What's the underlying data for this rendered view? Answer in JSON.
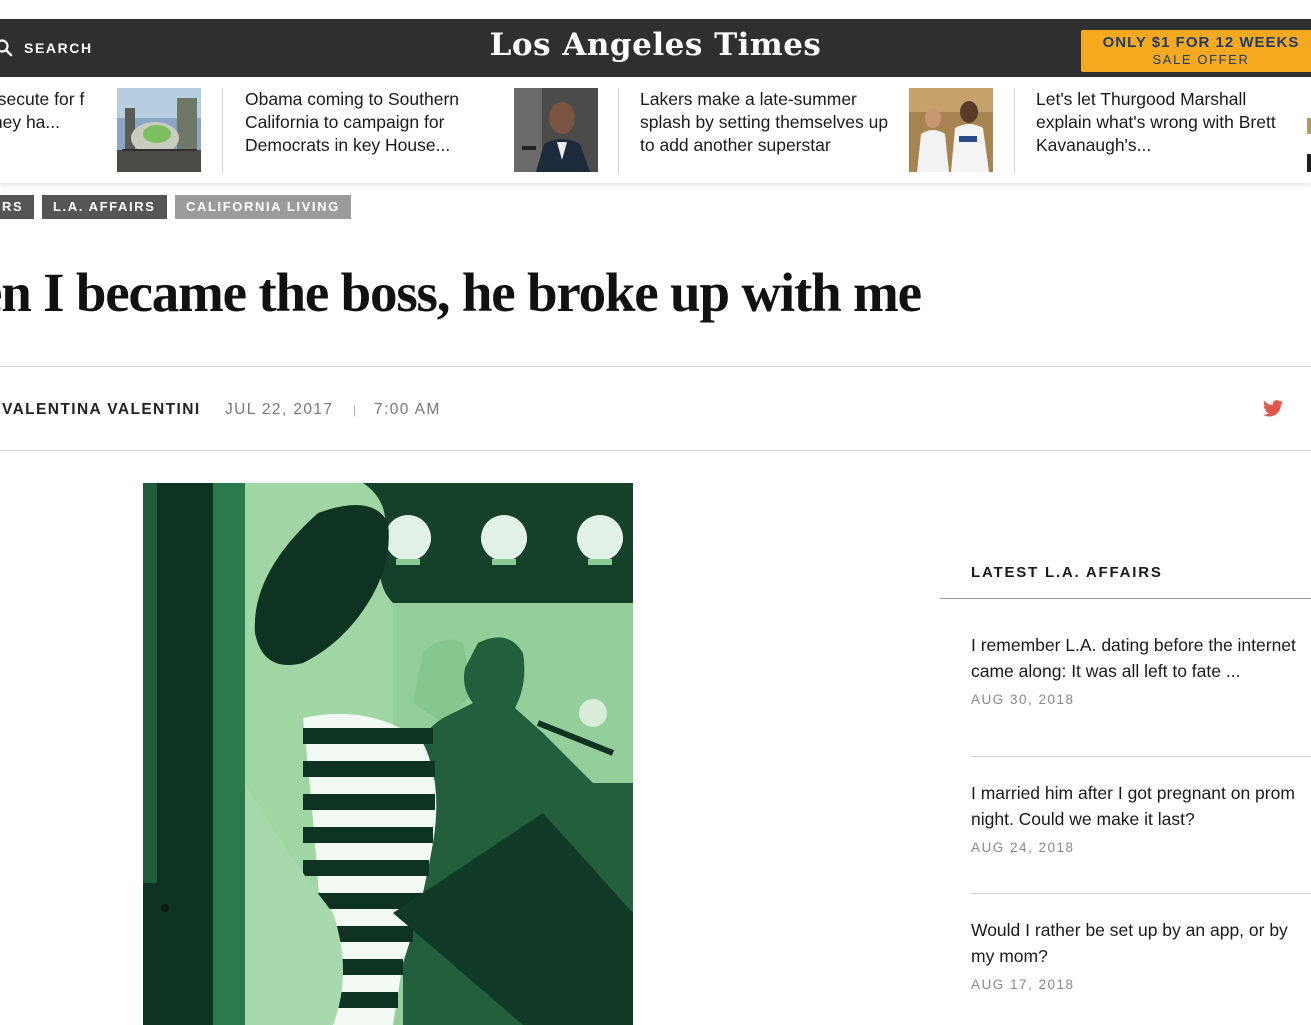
{
  "header": {
    "search_label": "SEARCH",
    "logo": "Los Angeles Times",
    "offer_main": "ONLY $1 FOR 12 WEEKS",
    "offer_sub": "SALE OFFER"
  },
  "strip": {
    "stories": [
      {
        "text": "osecute for f they ha..."
      },
      {
        "text": "Obama coming to Southern California to campaign for Democrats in key House..."
      },
      {
        "text": "Lakers make a late-summer splash by setting themselves up to add another superstar"
      },
      {
        "text": "Let's let Thurgood Marshall explain what's wrong with Brett Kavanaugh's..."
      }
    ]
  },
  "tags": [
    "RS",
    "L.A. AFFAIRS",
    "CALIFORNIA LIVING"
  ],
  "article": {
    "headline": "en I became the boss, he broke up with me",
    "author": "VALENTINA VALENTINI",
    "date": "JUL 22, 2017",
    "separator": "|",
    "time": "7:00 AM"
  },
  "sidebar": {
    "title": "LATEST L.A. AFFAIRS",
    "items": [
      {
        "title": "I remember L.A. dating before the internet came along: It was all left to fate ...",
        "date": "AUG 30, 2018"
      },
      {
        "title": "I married him after I got pregnant on prom night. Could we make it last?",
        "date": "AUG 24, 2018"
      },
      {
        "title": "Would I rather be set up by an app, or by my mom?",
        "date": "AUG 17, 2018"
      }
    ]
  },
  "colors": {
    "header_bg": "#2f2f2f",
    "offer_bg": "#f6a81f",
    "offer_text": "#1f3d66",
    "tag_dark": "#555555",
    "tag_light": "#9b9b9b",
    "twitter": "#e2574c"
  },
  "icons": {
    "search": "search-icon",
    "twitter": "twitter-icon"
  }
}
